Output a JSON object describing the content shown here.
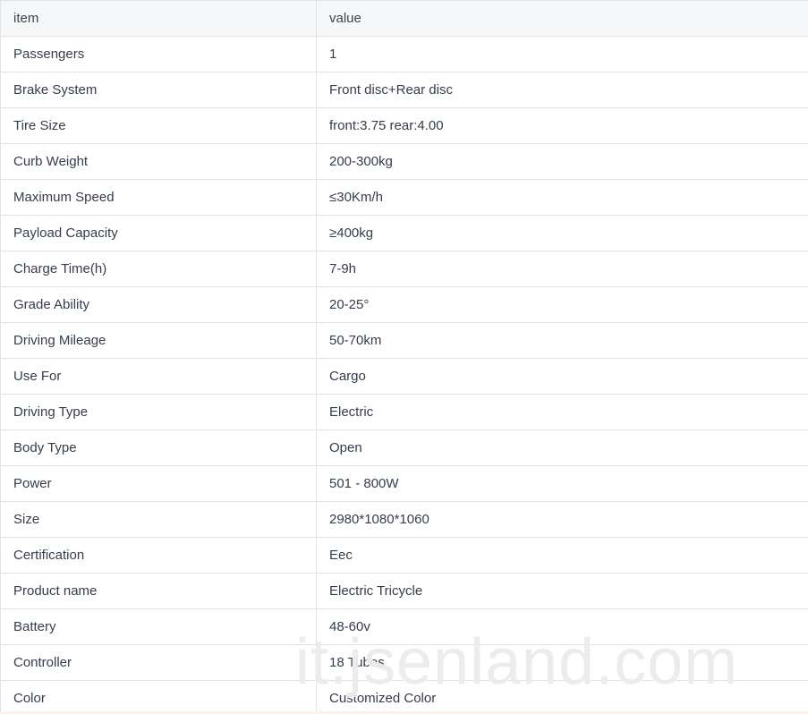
{
  "table": {
    "columns": [
      {
        "key": "item",
        "label": "item"
      },
      {
        "key": "value",
        "label": "value"
      }
    ],
    "rows": [
      {
        "item": "Passengers",
        "value": "1"
      },
      {
        "item": "Brake System",
        "value": "Front disc+Rear disc"
      },
      {
        "item": "Tire Size",
        "value": "front:3.75 rear:4.00"
      },
      {
        "item": "Curb Weight",
        "value": "200-300kg"
      },
      {
        "item": "Maximum Speed",
        "value": "≤30Km/h"
      },
      {
        "item": "Payload Capacity",
        "value": "≥400kg"
      },
      {
        "item": "Charge Time(h)",
        "value": "7-9h"
      },
      {
        "item": "Grade Ability",
        "value": "20-25°"
      },
      {
        "item": "Driving Mileage",
        "value": "50-70km"
      },
      {
        "item": "Use For",
        "value": "Cargo"
      },
      {
        "item": "Driving Type",
        "value": "Electric"
      },
      {
        "item": "Body Type",
        "value": "Open"
      },
      {
        "item": "Power",
        "value": "501 - 800W"
      },
      {
        "item": "Size",
        "value": "2980*1080*1060"
      },
      {
        "item": "Certification",
        "value": "Eec"
      },
      {
        "item": "Product name",
        "value": "Electric Tricycle"
      },
      {
        "item": "Battery",
        "value": "48-60v"
      },
      {
        "item": "Controller",
        "value": "18 Tubes"
      },
      {
        "item": "Color",
        "value": "Customized Color"
      }
    ]
  },
  "watermark": {
    "text": "it.jsenland.com"
  },
  "colors": {
    "header_background": "#f6f7f9",
    "border": "#dfe2e7",
    "text": "#353d49",
    "watermark": "#ececec",
    "page_background": "#ffffff"
  }
}
